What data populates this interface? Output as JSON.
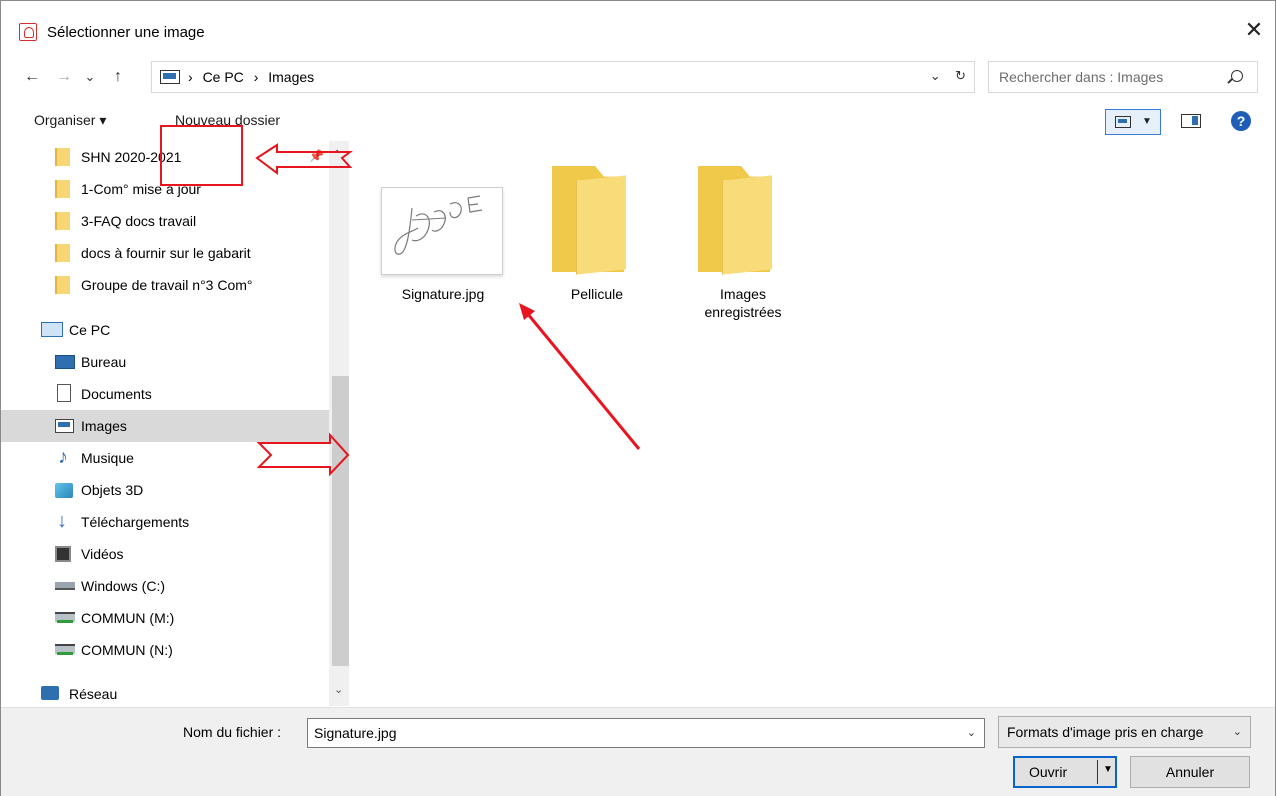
{
  "window": {
    "title": "Sélectionner une image",
    "close_label": "✕"
  },
  "nav": {
    "back": "←",
    "forward": "→",
    "recent": "⌄",
    "up": "↑",
    "breadcrumbs": [
      "Ce PC",
      "Images"
    ],
    "separator": "›",
    "dropdown": "⌄",
    "refresh": "↻",
    "search_placeholder": "Rechercher dans : Images"
  },
  "toolbar": {
    "organize_label": "Organiser ▾",
    "new_folder_label": "Nouveau dossier",
    "help_label": "?"
  },
  "sidebar": {
    "quick_access": [
      {
        "label": "SHN 2020-2021"
      },
      {
        "label": "1-Com° mise à jour"
      },
      {
        "label": "3-FAQ docs travail"
      },
      {
        "label": "docs à fournir sur le gabarit"
      },
      {
        "label": "Groupe de travail n°3 Com°"
      }
    ],
    "this_pc": "Ce PC",
    "pc_items": [
      {
        "label": "Bureau",
        "icon": "desktop-icon"
      },
      {
        "label": "Documents",
        "icon": "documents-icon"
      },
      {
        "label": "Images",
        "icon": "pictures-icon",
        "selected": true
      },
      {
        "label": "Musique",
        "icon": "music-icon"
      },
      {
        "label": "Objets 3D",
        "icon": "3d-objects-icon"
      },
      {
        "label": "Téléchargements",
        "icon": "downloads-icon"
      },
      {
        "label": "Vidéos",
        "icon": "videos-icon"
      },
      {
        "label": "Windows (C:)",
        "icon": "drive-icon"
      },
      {
        "label": "COMMUN (M:)",
        "icon": "network-drive-icon"
      },
      {
        "label": "COMMUN (N:)",
        "icon": "network-drive-icon"
      }
    ],
    "network": "Réseau"
  },
  "files": [
    {
      "name": "Signature.jpg",
      "type": "image"
    },
    {
      "name": "Pellicule",
      "type": "folder"
    },
    {
      "name": "Images enregistrées",
      "type": "folder"
    }
  ],
  "bottom": {
    "filename_label": "Nom du fichier :",
    "filename_value": "Signature.jpg",
    "format_value": "Formats d'image pris en charge",
    "open_label": "Ouvrir",
    "cancel_label": "Annuler"
  },
  "colors": {
    "annotation_red": "#e8141e",
    "selection_grey": "#d9d9d9",
    "accent_blue": "#0a63c8"
  }
}
